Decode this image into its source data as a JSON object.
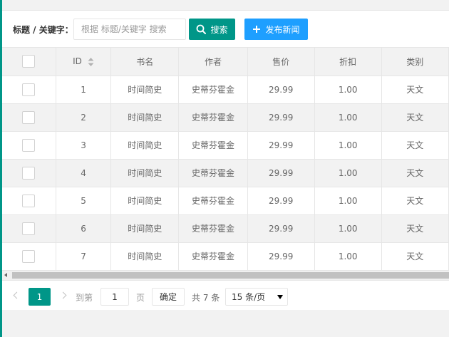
{
  "toolbar": {
    "search_label": "标题 / 关键字：",
    "search_placeholder": "根据 标题/关键字 搜索",
    "search_value": "",
    "search_button": "搜索",
    "add_button": "发布新闻"
  },
  "table": {
    "headers": [
      "ID",
      "书名",
      "作者",
      "售价",
      "折扣",
      "类别"
    ],
    "rows": [
      [
        "1",
        "时间简史",
        "史蒂芬霍金",
        "29.99",
        "1.00",
        "天文"
      ],
      [
        "2",
        "时间简史",
        "史蒂芬霍金",
        "29.99",
        "1.00",
        "天文"
      ],
      [
        "3",
        "时间简史",
        "史蒂芬霍金",
        "29.99",
        "1.00",
        "天文"
      ],
      [
        "4",
        "时间简史",
        "史蒂芬霍金",
        "29.99",
        "1.00",
        "天文"
      ],
      [
        "5",
        "时间简史",
        "史蒂芬霍金",
        "29.99",
        "1.00",
        "天文"
      ],
      [
        "6",
        "时间简史",
        "史蒂芬霍金",
        "29.99",
        "1.00",
        "天文"
      ],
      [
        "7",
        "时间简史",
        "史蒂芬霍金",
        "29.99",
        "1.00",
        "天文"
      ]
    ]
  },
  "pagination": {
    "current_page": "1",
    "goto_label": "到第",
    "goto_value": "1",
    "page_label": "页",
    "confirm_button": "确定",
    "total_text": "共 7 条",
    "page_size": "15 条/页"
  },
  "colors": {
    "primary": "#009688",
    "blue": "#1e9fff"
  }
}
